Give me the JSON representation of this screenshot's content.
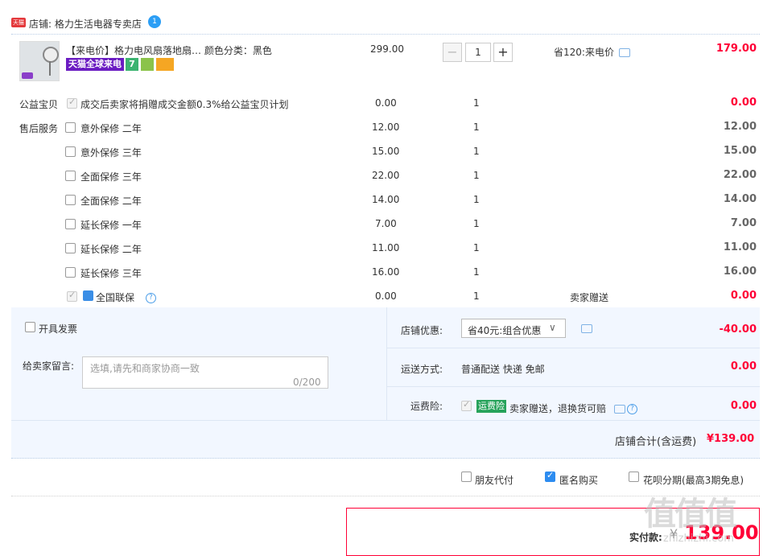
{
  "shop": {
    "prefix": "店铺: 格力生活电器专卖店",
    "logo_text": "天猫",
    "wangwang_text": "1"
  },
  "product": {
    "title": "【来电价】格力电风扇落地扇…  颜色分类：黑色",
    "badge_tmall": "天猫全球来电",
    "badge_7": "7",
    "price": "299.00",
    "qty": "1",
    "promo": "省120:来电价",
    "amount": "179.00"
  },
  "charity": {
    "label": "公益宝贝",
    "text": "成交后卖家将捐赠成交金额0.3%给公益宝贝计划",
    "price": "0.00",
    "qty": "1",
    "amount": "0.00"
  },
  "services": {
    "label": "售后服务",
    "items": [
      {
        "name": "意外保修  二年",
        "price": "12.00",
        "qty": "1",
        "amount": "12.00"
      },
      {
        "name": "意外保修  三年",
        "price": "15.00",
        "qty": "1",
        "amount": "15.00"
      },
      {
        "name": "全面保修  三年",
        "price": "22.00",
        "qty": "1",
        "amount": "22.00"
      },
      {
        "name": "全面保修  二年",
        "price": "14.00",
        "qty": "1",
        "amount": "14.00"
      },
      {
        "name": "延长保修  一年",
        "price": "7.00",
        "qty": "1",
        "amount": "7.00"
      },
      {
        "name": "延长保修  二年",
        "price": "11.00",
        "qty": "1",
        "amount": "11.00"
      },
      {
        "name": "延长保修  三年",
        "price": "16.00",
        "qty": "1",
        "amount": "16.00"
      }
    ],
    "national": {
      "name": "全国联保",
      "price": "0.00",
      "qty": "1",
      "note": "卖家赠送",
      "amount": "0.00"
    }
  },
  "invoice": {
    "label": "开具发票"
  },
  "message": {
    "label": "给卖家留言:",
    "placeholder": "选填,请先和商家协商一致",
    "count": "0/200"
  },
  "discount": {
    "label": "店铺优惠:",
    "selected": "省40元:组合优惠",
    "amount": "-40.00"
  },
  "shipping": {
    "label": "运送方式:",
    "value": "普通配送 快递 免邮",
    "amount": "0.00"
  },
  "insurance": {
    "label": "运费险:",
    "tag": "运费险",
    "text": "卖家赠送，退换货可赔",
    "amount": "0.00"
  },
  "shop_total": {
    "label": "店铺合计(含运费)",
    "value": "¥139.00"
  },
  "options": {
    "friend_pay": "朋友代付",
    "anonymous": "匿名购买",
    "installment": "花呗分期(最高3期免息)"
  },
  "payment": {
    "label": "实付款:",
    "currency": "¥",
    "value": "139.00"
  },
  "watermark": {
    "big": "值值值",
    "small": "zhizhizhi.com"
  }
}
